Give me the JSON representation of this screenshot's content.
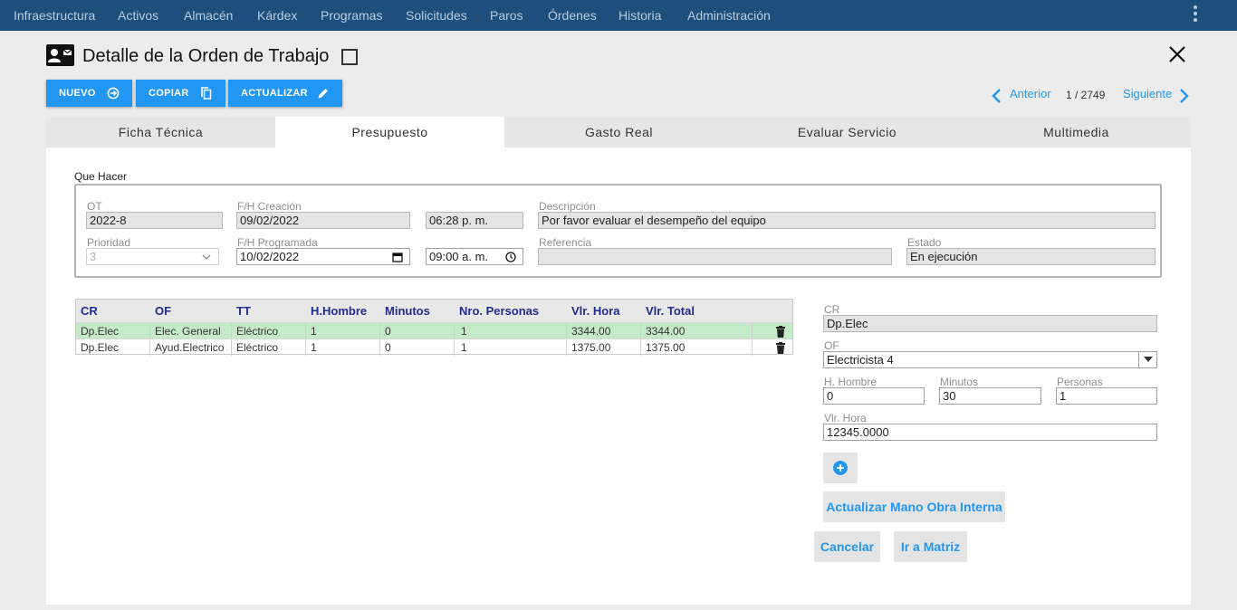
{
  "nav": {
    "items": [
      "Infraestructura",
      "Activos",
      "Almacén",
      "Kárdex",
      "Programas",
      "Solicitudes",
      "Paros",
      "Órdenes",
      "Historia",
      "Administración"
    ]
  },
  "header": {
    "title": "Detalle de la Orden de Trabajo"
  },
  "toolbar": {
    "nuevo": "NUEVO",
    "copiar": "COPIAR",
    "actualizar": "ACTUALIZAR"
  },
  "pager": {
    "prev": "Anterior",
    "count": "1 / 2749",
    "next": "Siguiente"
  },
  "tabs": [
    "Ficha Técnica",
    "Presupuesto",
    "Gasto Real",
    "Evaluar Servicio",
    "Multimedia"
  ],
  "active_tab": "Presupuesto",
  "que_hacer": {
    "legend": "Que Hacer",
    "ot_label": "OT",
    "ot_value": "2022-8",
    "creacion_label": "F/H Creación",
    "creacion_date": "09/02/2022",
    "creacion_time": "06:28  p. m.",
    "descripcion_label": "Descripción",
    "descripcion_value": "Por favor evaluar el desempeño del equipo",
    "prioridad_label": "Prioridad",
    "prioridad_value": "3",
    "programada_label": "F/H Programada",
    "programada_date": "10/02/2022",
    "programada_time": "09:00  a. m.",
    "referencia_label": "Referencia",
    "referencia_value": "",
    "estado_label": "Estado",
    "estado_value": "En ejecución"
  },
  "grid": {
    "headers": [
      "CR",
      "OF",
      "TT",
      "H.Hombre",
      "Minutos",
      "Nro. Personas",
      "Vlr. Hora",
      "Vlr. Total"
    ],
    "rows": [
      [
        "Dp.Elec",
        "Elec. General",
        "Eléctrico",
        "1",
        "0",
        "1",
        "3344.00",
        "3344.00"
      ],
      [
        "Dp.Elec",
        "Ayud.Electrico",
        "Eléctrico",
        "1",
        "0",
        "1",
        "1375.00",
        "1375.00"
      ]
    ],
    "selected_row": 0
  },
  "form": {
    "cr_label": "CR",
    "cr_value": "Dp.Elec",
    "of_label": "OF",
    "of_value": "Electricista 4",
    "hhombre_label": "H. Hombre",
    "hhombre_value": "0",
    "minutos_label": "Minutos",
    "minutos_value": "30",
    "personas_label": "Personas",
    "personas_value": "1",
    "vlrhora_label": "Vlr. Hora",
    "vlrhora_value": "12345.0000",
    "actualizar_label": "Actualizar Mano Obra Interna",
    "cancelar_label": "Cancelar",
    "matriz_label": "Ir a Matriz"
  },
  "colors": {
    "nav_bg": "#1d4e7c",
    "accent": "#2196f3",
    "selected_row": "#c4eac8",
    "header_text": "#1f2d8f"
  },
  "icons": [
    "contact-card-icon",
    "checkbox-icon",
    "close-icon",
    "arrow-circle-icon",
    "copy-icon",
    "pencil-icon",
    "chevron-left-icon",
    "chevron-right-icon",
    "chevron-down-icon",
    "calendar-icon",
    "clock-icon",
    "trash-icon",
    "plus-circle-icon",
    "kebab-menu-icon"
  ]
}
